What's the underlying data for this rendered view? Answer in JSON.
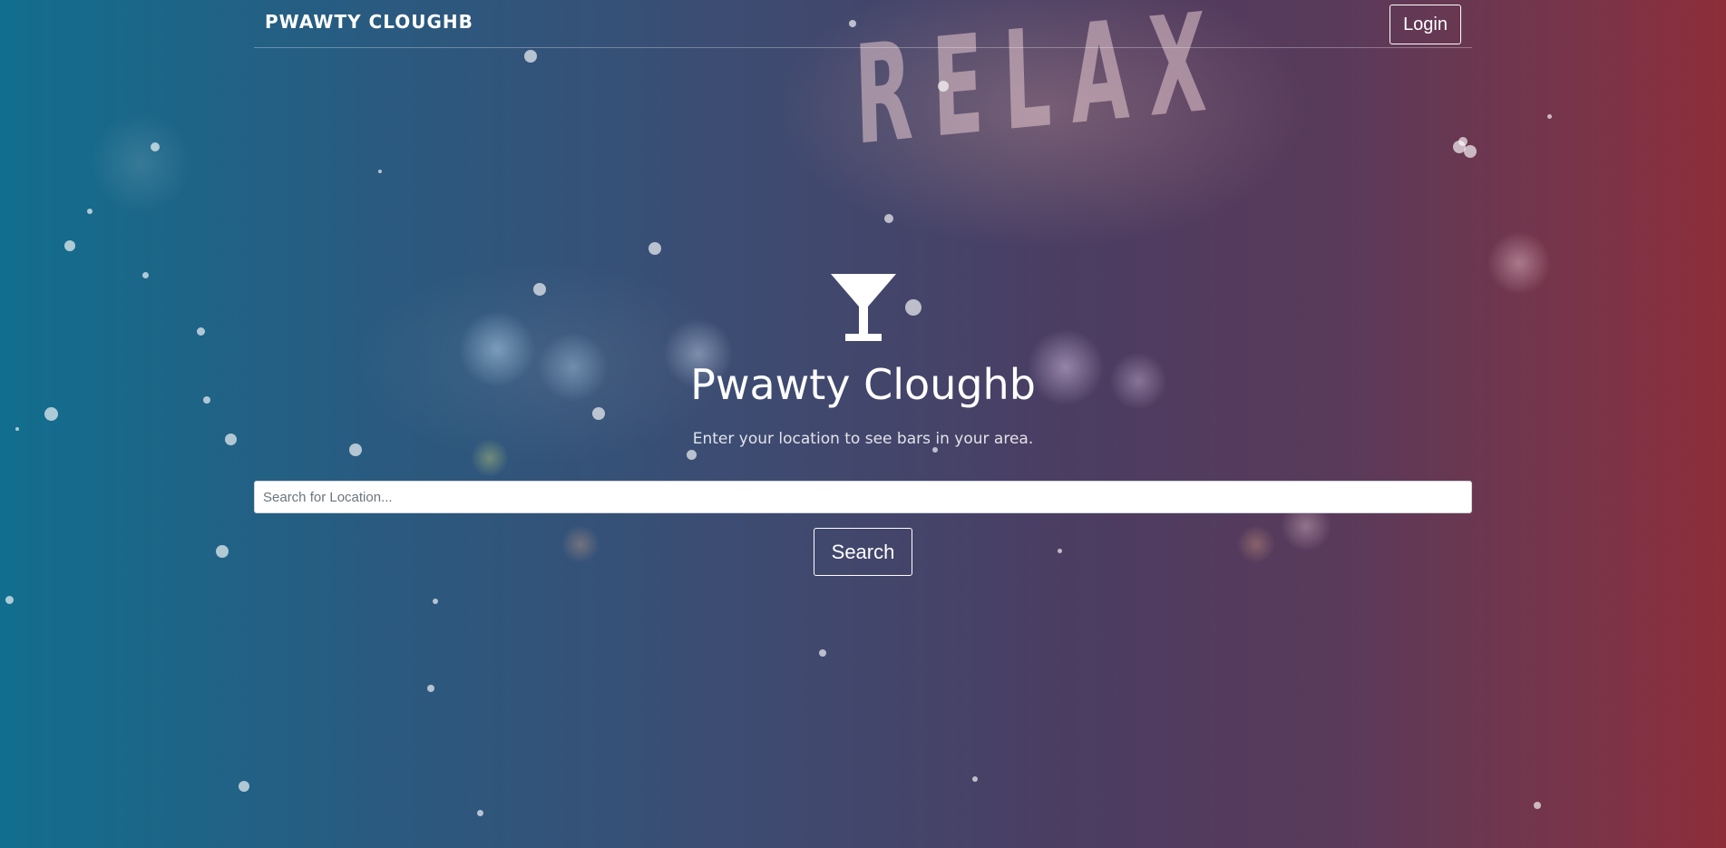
{
  "navbar": {
    "brand": "PWAWTY CLOUGHB",
    "login_label": "Login"
  },
  "background": {
    "sign_text": "RELAX"
  },
  "hero": {
    "icon": "martini-glass-icon",
    "title": "Pwawty Cloughb",
    "subtitle": "Enter your location to see bars in your area."
  },
  "search": {
    "placeholder": "Search for Location...",
    "value": "",
    "button_label": "Search"
  },
  "colors": {
    "gradient_left": "#126e8e",
    "gradient_mid": "#4b3d62",
    "gradient_right": "#8d2d3a",
    "text": "#ffffff",
    "input_bg": "#ffffff"
  }
}
